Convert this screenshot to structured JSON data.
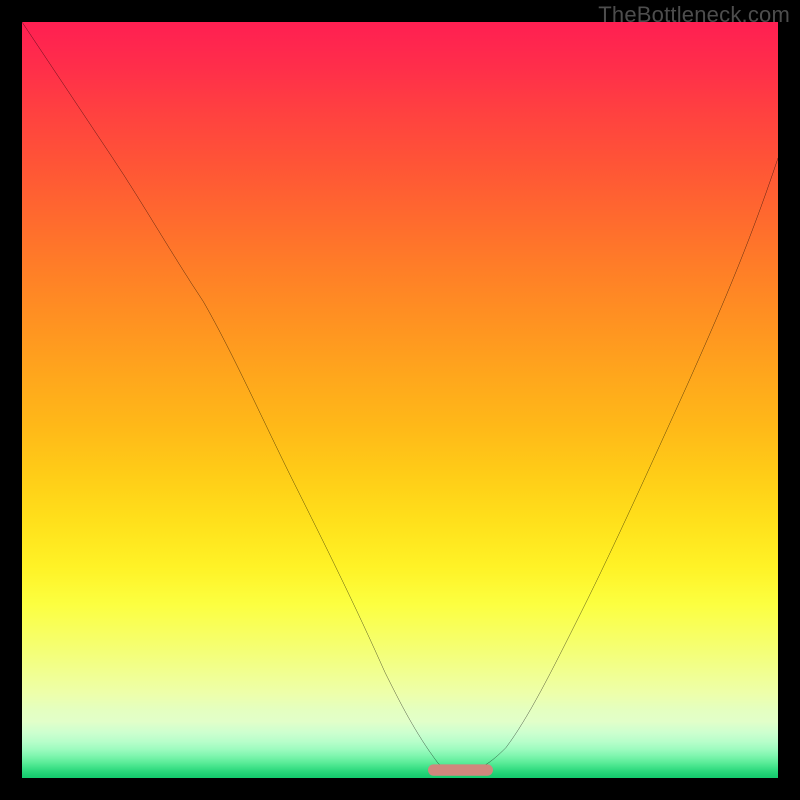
{
  "watermark": "TheBottleneck.com",
  "chart_data": {
    "type": "line",
    "title": "",
    "xlabel": "",
    "ylabel": "",
    "xlim": [
      0,
      100
    ],
    "ylim": [
      0,
      100
    ],
    "grid": false,
    "series": [
      {
        "name": "bottleneck-curve",
        "x": [
          0,
          6,
          12,
          18,
          24,
          30,
          36,
          42,
          48,
          52,
          55,
          57,
          59,
          62,
          66,
          72,
          78,
          84,
          90,
          96,
          100
        ],
        "values": [
          100,
          91,
          82,
          73,
          63,
          51,
          39,
          27,
          14,
          6,
          2,
          1,
          1,
          2,
          7,
          19,
          33,
          47,
          60,
          73,
          82
        ]
      }
    ],
    "marker": {
      "name": "optimal-zone",
      "x_center": 58,
      "width": 8,
      "y": 0.8,
      "color": "#d1877d"
    },
    "background_gradient": {
      "top": "#ff1f52",
      "mid": "#ffe01b",
      "bottom": "#14ca6d"
    }
  }
}
